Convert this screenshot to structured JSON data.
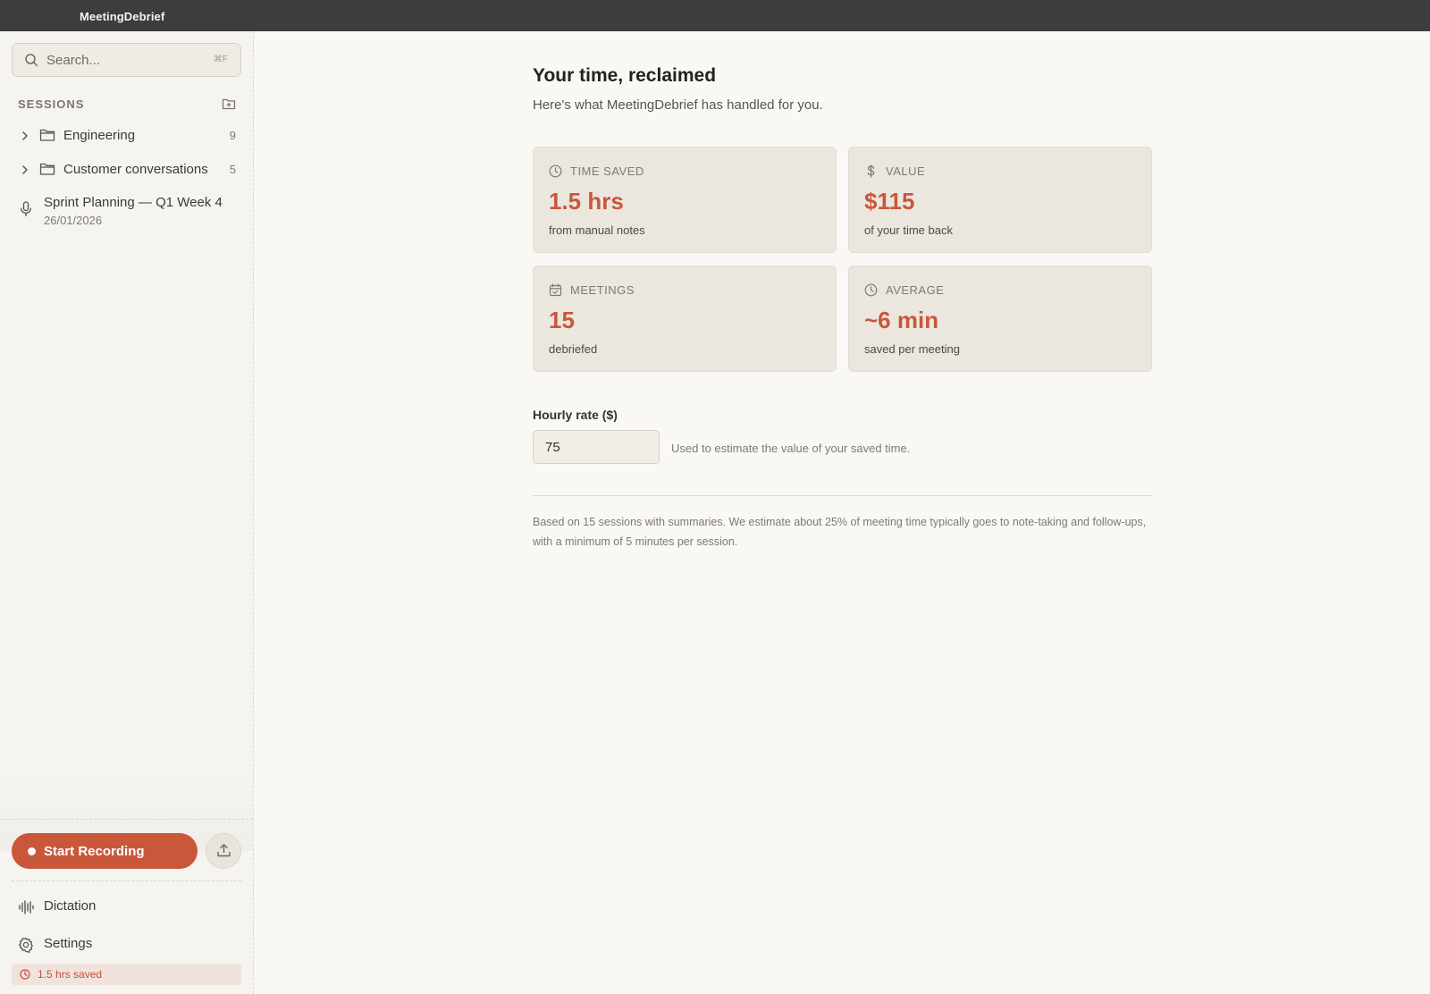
{
  "app": {
    "title": "MeetingDebrief"
  },
  "search": {
    "placeholder": "Search...",
    "shortcut": "⌘F"
  },
  "sessions": {
    "header": "SESSIONS",
    "folders": [
      {
        "name": "Engineering",
        "count": "9"
      },
      {
        "name": "Customer conversations",
        "count": "5"
      }
    ],
    "items": [
      {
        "title": "Sprint Planning — Q1 Week 4",
        "date": "26/01/2026"
      }
    ]
  },
  "actions": {
    "record_label": "Start Recording"
  },
  "nav": {
    "dictation": "Dictation",
    "settings": "Settings"
  },
  "badge": {
    "saved": "1.5 hrs saved"
  },
  "main": {
    "title": "Your time, reclaimed",
    "subtitle": "Here's what MeetingDebrief has handled for you.",
    "cards": [
      {
        "icon": "clock-icon",
        "label": "TIME SAVED",
        "value": "1.5 hrs",
        "sub": "from manual notes"
      },
      {
        "icon": "dollar-icon",
        "label": "VALUE",
        "value": "$115",
        "sub": "of your time back"
      },
      {
        "icon": "calendar-check-icon",
        "label": "MEETINGS",
        "value": "15",
        "sub": "debriefed"
      },
      {
        "icon": "clock-icon",
        "label": "AVERAGE",
        "value": "~6 min",
        "sub": "saved per meeting"
      }
    ],
    "rate": {
      "label": "Hourly rate ($)",
      "value": "75",
      "hint": "Used to estimate the value of your saved time."
    },
    "footnote": "Based on 15 sessions with summaries. We estimate about 25% of meeting time typically goes to note-taking and follow-ups, with a minimum of 5 minutes per session."
  },
  "colors": {
    "accent": "#c9573a",
    "card_bg": "#ebe7df",
    "sidebar_bg": "#f6f4ef",
    "titlebar_bg": "#3d3d3d"
  }
}
